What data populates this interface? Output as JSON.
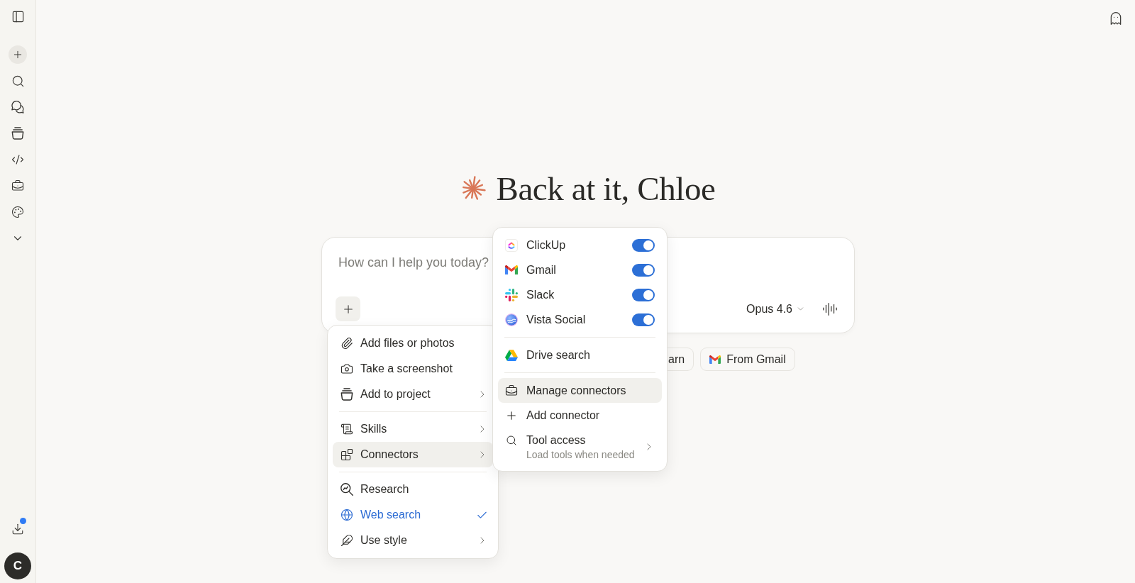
{
  "sidebar": {
    "download_badge": true,
    "avatar": {
      "initial": "C"
    }
  },
  "greeting": {
    "title": "Back at it, Chloe"
  },
  "composer": {
    "placeholder": "How can I help you today?",
    "model": "Opus 4.6"
  },
  "connectors_menu": {
    "connectors": [
      {
        "name": "ClickUp",
        "on": true
      },
      {
        "name": "Gmail",
        "on": true
      },
      {
        "name": "Slack",
        "on": true
      },
      {
        "name": "Vista Social",
        "on": true
      }
    ],
    "sources": [
      {
        "label": "Drive search"
      }
    ],
    "actions": [
      {
        "label": "Manage connectors",
        "selected": true,
        "submenu": false
      },
      {
        "label": "Add connector",
        "selected": false,
        "submenu": false
      },
      {
        "label": "Tool access",
        "description": "Load tools when needed",
        "selected": false,
        "submenu": true
      }
    ]
  },
  "add_menu": {
    "sections": [
      {
        "items": [
          {
            "label": "Add files or photos",
            "selected": false,
            "checked": false,
            "submenu": false
          },
          {
            "label": "Take a screenshot",
            "selected": false,
            "checked": false,
            "submenu": false
          },
          {
            "label": "Add to project",
            "selected": false,
            "checked": false,
            "submenu": true
          }
        ]
      },
      {
        "items": [
          {
            "label": "Skills",
            "selected": false,
            "checked": false,
            "submenu": true
          },
          {
            "label": "Connectors",
            "selected": true,
            "checked": false,
            "submenu": true
          }
        ]
      },
      {
        "items": [
          {
            "label": "Research",
            "selected": false,
            "checked": false,
            "submenu": false
          },
          {
            "label": "Web search",
            "selected": false,
            "checked": true,
            "submenu": false
          },
          {
            "label": "Use style",
            "selected": false,
            "checked": false,
            "submenu": true
          }
        ]
      }
    ]
  },
  "suggestions": [
    {
      "label": "arn",
      "kind": "plain"
    },
    {
      "label": "From Gmail",
      "kind": "gmail"
    }
  ]
}
